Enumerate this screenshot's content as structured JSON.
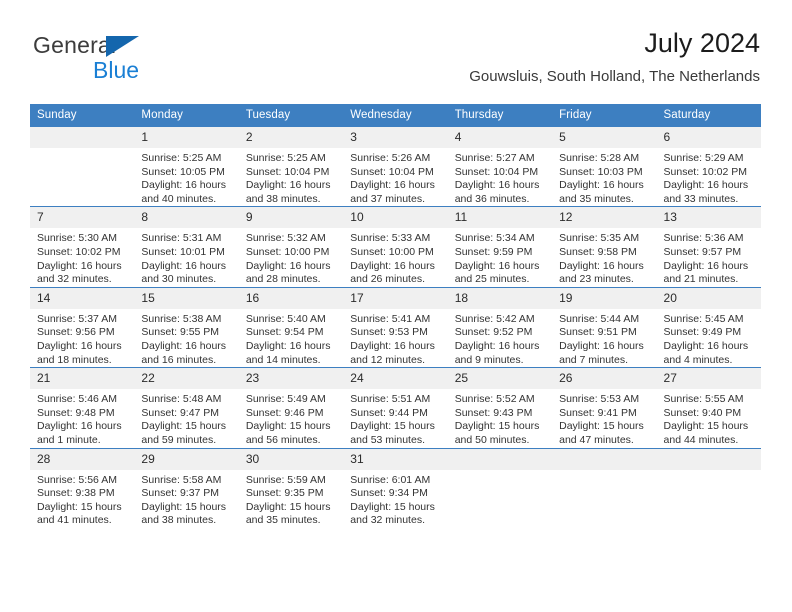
{
  "brand": {
    "name_part1": "General",
    "name_part2": "Blue",
    "accent_color": "#1a7fd4",
    "triangle_color": "#1466ad"
  },
  "header": {
    "title": "July 2024",
    "subtitle": "Gouwsluis, South Holland, The Netherlands"
  },
  "calendar": {
    "header_color": "#3d7fc1",
    "daynum_background": "#f0f0f0",
    "weekday_headers": [
      "Sunday",
      "Monday",
      "Tuesday",
      "Wednesday",
      "Thursday",
      "Friday",
      "Saturday"
    ],
    "weeks": [
      [
        {
          "day": "",
          "empty": true,
          "sunrise": "",
          "sunset": "",
          "daylight_line1": "",
          "daylight_line2": ""
        },
        {
          "day": "1",
          "empty": false,
          "sunrise": "Sunrise: 5:25 AM",
          "sunset": "Sunset: 10:05 PM",
          "daylight_line1": "Daylight: 16 hours",
          "daylight_line2": "and 40 minutes."
        },
        {
          "day": "2",
          "empty": false,
          "sunrise": "Sunrise: 5:25 AM",
          "sunset": "Sunset: 10:04 PM",
          "daylight_line1": "Daylight: 16 hours",
          "daylight_line2": "and 38 minutes."
        },
        {
          "day": "3",
          "empty": false,
          "sunrise": "Sunrise: 5:26 AM",
          "sunset": "Sunset: 10:04 PM",
          "daylight_line1": "Daylight: 16 hours",
          "daylight_line2": "and 37 minutes."
        },
        {
          "day": "4",
          "empty": false,
          "sunrise": "Sunrise: 5:27 AM",
          "sunset": "Sunset: 10:04 PM",
          "daylight_line1": "Daylight: 16 hours",
          "daylight_line2": "and 36 minutes."
        },
        {
          "day": "5",
          "empty": false,
          "sunrise": "Sunrise: 5:28 AM",
          "sunset": "Sunset: 10:03 PM",
          "daylight_line1": "Daylight: 16 hours",
          "daylight_line2": "and 35 minutes."
        },
        {
          "day": "6",
          "empty": false,
          "sunrise": "Sunrise: 5:29 AM",
          "sunset": "Sunset: 10:02 PM",
          "daylight_line1": "Daylight: 16 hours",
          "daylight_line2": "and 33 minutes."
        }
      ],
      [
        {
          "day": "7",
          "empty": false,
          "sunrise": "Sunrise: 5:30 AM",
          "sunset": "Sunset: 10:02 PM",
          "daylight_line1": "Daylight: 16 hours",
          "daylight_line2": "and 32 minutes."
        },
        {
          "day": "8",
          "empty": false,
          "sunrise": "Sunrise: 5:31 AM",
          "sunset": "Sunset: 10:01 PM",
          "daylight_line1": "Daylight: 16 hours",
          "daylight_line2": "and 30 minutes."
        },
        {
          "day": "9",
          "empty": false,
          "sunrise": "Sunrise: 5:32 AM",
          "sunset": "Sunset: 10:00 PM",
          "daylight_line1": "Daylight: 16 hours",
          "daylight_line2": "and 28 minutes."
        },
        {
          "day": "10",
          "empty": false,
          "sunrise": "Sunrise: 5:33 AM",
          "sunset": "Sunset: 10:00 PM",
          "daylight_line1": "Daylight: 16 hours",
          "daylight_line2": "and 26 minutes."
        },
        {
          "day": "11",
          "empty": false,
          "sunrise": "Sunrise: 5:34 AM",
          "sunset": "Sunset: 9:59 PM",
          "daylight_line1": "Daylight: 16 hours",
          "daylight_line2": "and 25 minutes."
        },
        {
          "day": "12",
          "empty": false,
          "sunrise": "Sunrise: 5:35 AM",
          "sunset": "Sunset: 9:58 PM",
          "daylight_line1": "Daylight: 16 hours",
          "daylight_line2": "and 23 minutes."
        },
        {
          "day": "13",
          "empty": false,
          "sunrise": "Sunrise: 5:36 AM",
          "sunset": "Sunset: 9:57 PM",
          "daylight_line1": "Daylight: 16 hours",
          "daylight_line2": "and 21 minutes."
        }
      ],
      [
        {
          "day": "14",
          "empty": false,
          "sunrise": "Sunrise: 5:37 AM",
          "sunset": "Sunset: 9:56 PM",
          "daylight_line1": "Daylight: 16 hours",
          "daylight_line2": "and 18 minutes."
        },
        {
          "day": "15",
          "empty": false,
          "sunrise": "Sunrise: 5:38 AM",
          "sunset": "Sunset: 9:55 PM",
          "daylight_line1": "Daylight: 16 hours",
          "daylight_line2": "and 16 minutes."
        },
        {
          "day": "16",
          "empty": false,
          "sunrise": "Sunrise: 5:40 AM",
          "sunset": "Sunset: 9:54 PM",
          "daylight_line1": "Daylight: 16 hours",
          "daylight_line2": "and 14 minutes."
        },
        {
          "day": "17",
          "empty": false,
          "sunrise": "Sunrise: 5:41 AM",
          "sunset": "Sunset: 9:53 PM",
          "daylight_line1": "Daylight: 16 hours",
          "daylight_line2": "and 12 minutes."
        },
        {
          "day": "18",
          "empty": false,
          "sunrise": "Sunrise: 5:42 AM",
          "sunset": "Sunset: 9:52 PM",
          "daylight_line1": "Daylight: 16 hours",
          "daylight_line2": "and 9 minutes."
        },
        {
          "day": "19",
          "empty": false,
          "sunrise": "Sunrise: 5:44 AM",
          "sunset": "Sunset: 9:51 PM",
          "daylight_line1": "Daylight: 16 hours",
          "daylight_line2": "and 7 minutes."
        },
        {
          "day": "20",
          "empty": false,
          "sunrise": "Sunrise: 5:45 AM",
          "sunset": "Sunset: 9:49 PM",
          "daylight_line1": "Daylight: 16 hours",
          "daylight_line2": "and 4 minutes."
        }
      ],
      [
        {
          "day": "21",
          "empty": false,
          "sunrise": "Sunrise: 5:46 AM",
          "sunset": "Sunset: 9:48 PM",
          "daylight_line1": "Daylight: 16 hours",
          "daylight_line2": "and 1 minute."
        },
        {
          "day": "22",
          "empty": false,
          "sunrise": "Sunrise: 5:48 AM",
          "sunset": "Sunset: 9:47 PM",
          "daylight_line1": "Daylight: 15 hours",
          "daylight_line2": "and 59 minutes."
        },
        {
          "day": "23",
          "empty": false,
          "sunrise": "Sunrise: 5:49 AM",
          "sunset": "Sunset: 9:46 PM",
          "daylight_line1": "Daylight: 15 hours",
          "daylight_line2": "and 56 minutes."
        },
        {
          "day": "24",
          "empty": false,
          "sunrise": "Sunrise: 5:51 AM",
          "sunset": "Sunset: 9:44 PM",
          "daylight_line1": "Daylight: 15 hours",
          "daylight_line2": "and 53 minutes."
        },
        {
          "day": "25",
          "empty": false,
          "sunrise": "Sunrise: 5:52 AM",
          "sunset": "Sunset: 9:43 PM",
          "daylight_line1": "Daylight: 15 hours",
          "daylight_line2": "and 50 minutes."
        },
        {
          "day": "26",
          "empty": false,
          "sunrise": "Sunrise: 5:53 AM",
          "sunset": "Sunset: 9:41 PM",
          "daylight_line1": "Daylight: 15 hours",
          "daylight_line2": "and 47 minutes."
        },
        {
          "day": "27",
          "empty": false,
          "sunrise": "Sunrise: 5:55 AM",
          "sunset": "Sunset: 9:40 PM",
          "daylight_line1": "Daylight: 15 hours",
          "daylight_line2": "and 44 minutes."
        }
      ],
      [
        {
          "day": "28",
          "empty": false,
          "sunrise": "Sunrise: 5:56 AM",
          "sunset": "Sunset: 9:38 PM",
          "daylight_line1": "Daylight: 15 hours",
          "daylight_line2": "and 41 minutes."
        },
        {
          "day": "29",
          "empty": false,
          "sunrise": "Sunrise: 5:58 AM",
          "sunset": "Sunset: 9:37 PM",
          "daylight_line1": "Daylight: 15 hours",
          "daylight_line2": "and 38 minutes."
        },
        {
          "day": "30",
          "empty": false,
          "sunrise": "Sunrise: 5:59 AM",
          "sunset": "Sunset: 9:35 PM",
          "daylight_line1": "Daylight: 15 hours",
          "daylight_line2": "and 35 minutes."
        },
        {
          "day": "31",
          "empty": false,
          "sunrise": "Sunrise: 6:01 AM",
          "sunset": "Sunset: 9:34 PM",
          "daylight_line1": "Daylight: 15 hours",
          "daylight_line2": "and 32 minutes."
        },
        {
          "day": "",
          "empty": true,
          "sunrise": "",
          "sunset": "",
          "daylight_line1": "",
          "daylight_line2": ""
        },
        {
          "day": "",
          "empty": true,
          "sunrise": "",
          "sunset": "",
          "daylight_line1": "",
          "daylight_line2": ""
        },
        {
          "day": "",
          "empty": true,
          "sunrise": "",
          "sunset": "",
          "daylight_line1": "",
          "daylight_line2": ""
        }
      ]
    ]
  }
}
